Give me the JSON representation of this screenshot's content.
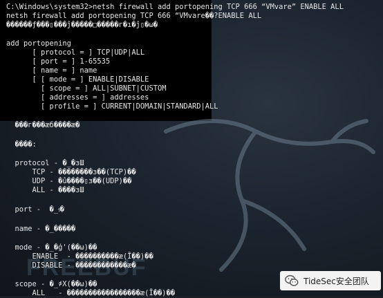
{
  "terminal": {
    "lines": [
      "C:\\Windows\\system32>netsh firewall add portopening TCP 666 “VMvare” ENABLE ALL",
      "netsh firewall add portopening TCP 666 “VMvare��?ENABLE ALL",
      "������ƒ���▯���ĵ�����□�����г�ı�ĵ▯�ω�",
      "",
      "add portopening",
      "      [ protocol = ] TCP|UDP|ALL",
      "      [ port = ] 1-65535",
      "      [ name = ] name",
      "      [ [ mode = ] ENABLE|DISABLE",
      "        [ scope = ] ALL|SUBNET|CUSTOM",
      "        [ addresses = ] addresses",
      "        [ profile = ] CURRENT|DOMAIN|STANDARD|ALL",
      "",
      "  ���г���æб����æ�",
      "",
      "  ����:",
      "",
      "  protocol - �_�зШ",
      "      TCP - ��������з��(TCP)��",
      "      UDP - �û����▯з��(UDP)��",
      "      ALL - ����зШ",
      "",
      "  port -  �_ࡳ�",
      "",
      "  name - �_�����",
      "",
      "  mode - �_�ģ'(��ω)��",
      "      ENABLE  - ����������æ(Ī��)��",
      "      DISABLE - ������������æ�",
      "",
      "  scope - �_҂X(��ω)��",
      "      ALL   - �����������������æ(Ī��)��"
    ]
  },
  "watermark": "TideSec安全团队",
  "background_watermark": "FREEBUF",
  "colors": {
    "terminal_text": "#e6e6e6",
    "terminal_bg": "#000000",
    "desktop_bg": "#1c2530"
  },
  "icons": {
    "badge_icon": "wechat-icon",
    "background_logo": "kali-dragon-icon"
  }
}
